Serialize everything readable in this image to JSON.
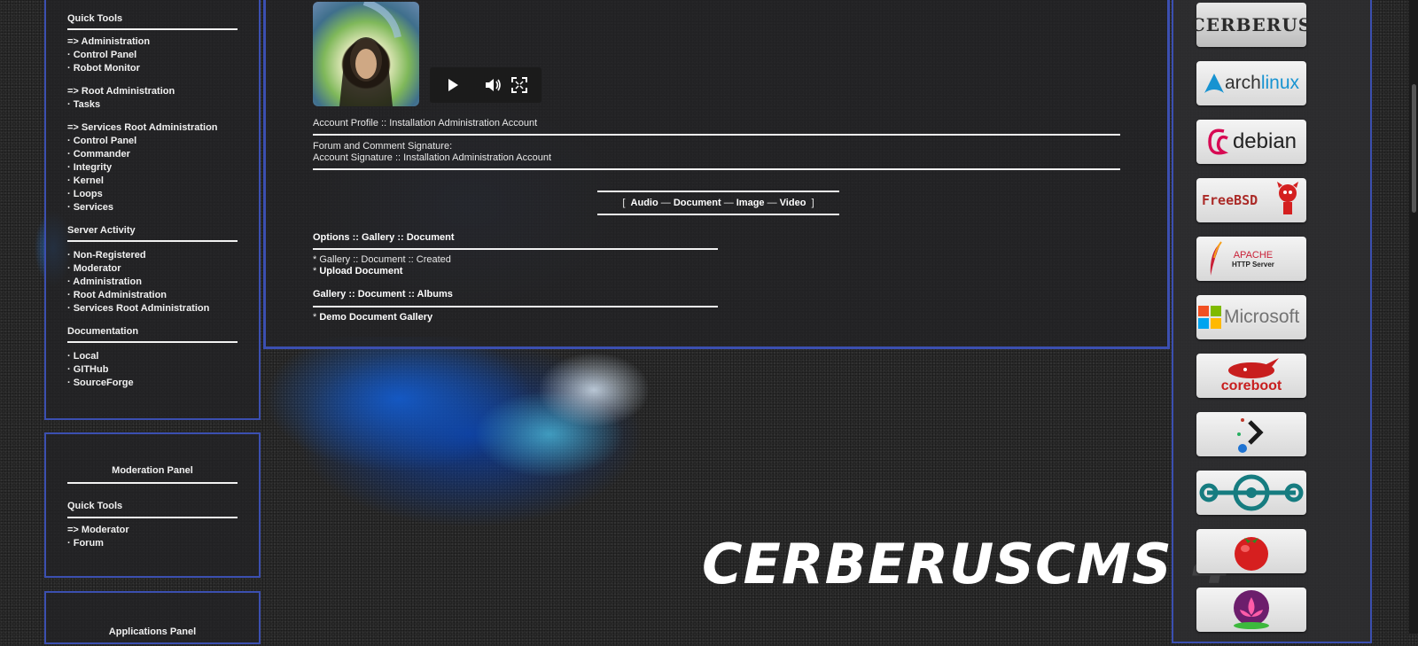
{
  "left_panel": {
    "quick_tools_title": "Quick Tools",
    "admin_header": "=> Administration",
    "admin_items": [
      "· Control Panel",
      "· Robot Monitor"
    ],
    "root_header": "=> Root Administration",
    "root_items": [
      "· Tasks"
    ],
    "services_header": "=> Services Root Administration",
    "services_items": [
      "· Control Panel",
      "· Commander",
      "· Integrity",
      "· Kernel",
      "· Loops",
      "· Services"
    ],
    "activity_title": "Server Activity",
    "activity_items": [
      "· Non-Registered",
      "· Moderator",
      "· Administration",
      "· Root Administration",
      "· Services Root Administration"
    ],
    "docs_title": "Documentation",
    "docs_items": [
      "· Local",
      "· GITHub",
      "· SourceForge"
    ]
  },
  "moderation_panel": {
    "title": "Moderation Panel",
    "quick_tools_title": "Quick Tools",
    "header": "=> Moderator",
    "items": [
      "· Forum"
    ]
  },
  "applications_panel": {
    "title": "Applications Panel"
  },
  "center": {
    "profile_line": "Account Profile :: Installation Administration Account",
    "signature_label": "Forum and Comment Signature:",
    "signature_value": "Account Signature :: Installation Administration Account",
    "media_nav": {
      "open_bracket": "[",
      "audio": "Audio",
      "sep": "—",
      "document": "Document",
      "image": "Image",
      "video": "Video",
      "close_bracket": "]"
    },
    "options_title": "Options :: Gallery :: Document",
    "options_created": "* Gallery :: Document :: Created",
    "options_upload_prefix": "*",
    "options_upload": "Upload Document",
    "albums_title": "Gallery :: Document :: Albums",
    "albums_prefix": "*",
    "albums_item": "Demo Document Gallery"
  },
  "hero_title": "CERBERUSCMS 4",
  "right_logos": {
    "cerberus": "CERBERUS",
    "arch_a": "arch",
    "arch_b": "linux",
    "debian": "debian",
    "freebsd": "FreeBSD",
    "apache_a": "APACHE",
    "apache_b": "HTTP Server",
    "microsoft": "Microsoft",
    "coreboot": "coreboot"
  },
  "colors": {
    "panel_border": "#3b4fb0",
    "link_white": "#ffffff"
  }
}
